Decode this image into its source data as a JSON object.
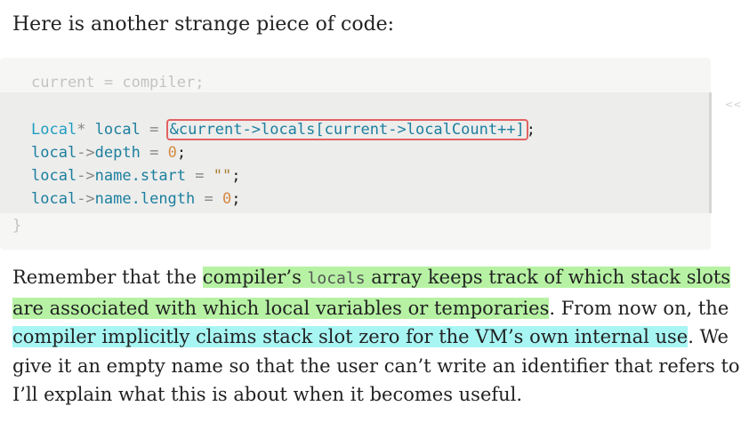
{
  "intro": "Here is another strange piece of code:",
  "code": {
    "line1": "current = compiler;",
    "l2_type": "Local",
    "l2_star": "*",
    "l2_var": "local",
    "l2_eq": "=",
    "l2_boxed": "&current->locals[current->localCount++]",
    "l2_semi": ";",
    "l3_obj": "local",
    "l3_arrow": "->",
    "l3_field": "depth",
    "l3_eq": "=",
    "l3_val": "0",
    "l3_semi": ";",
    "l4_obj": "local",
    "l4_arrow": "->",
    "l4_field": "name.start",
    "l4_eq": "=",
    "l4_val": "\"\"",
    "l4_semi": ";",
    "l5_obj": "local",
    "l5_arrow": "->",
    "l5_field": "name.length",
    "l5_eq": "=",
    "l5_val": "0",
    "l5_semi": ";",
    "closing_brace": "}"
  },
  "margin_marker": "<<",
  "paragraph": {
    "p1": "Remember that the ",
    "p2": "compiler’s ",
    "p3": "locals",
    "p4": " array keeps track of which stack slots",
    "p5": "are associated with which local variables or temporaries",
    "p6": ". From now on, the",
    "p7": "compiler implicitly claims stack slot zero for the VM’s own internal use",
    "p8": ". We",
    "p9": "give it an empty name so that the user can’t write an identifier that refers to it.",
    "p10": "I’ll explain what this is about when it becomes useful."
  },
  "colors": {
    "highlight_green": "#b7f2a4",
    "highlight_cyan": "#a8f6f4",
    "box_outline": "#e26262",
    "code_background": "#f6f6f5"
  }
}
